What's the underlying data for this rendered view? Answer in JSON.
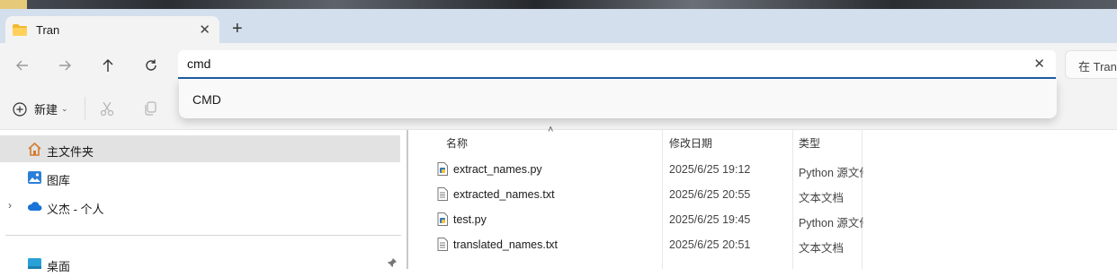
{
  "tab": {
    "title": "Tran"
  },
  "address": {
    "value": "cmd"
  },
  "search": {
    "placeholder": "在 Tran"
  },
  "suggestion": {
    "label": "CMD"
  },
  "toolbar": {
    "new_label": "新建"
  },
  "sidebar": {
    "items": [
      {
        "label": "主文件夹",
        "icon": "home-icon"
      },
      {
        "label": "图库",
        "icon": "gallery-icon"
      },
      {
        "label": "义杰 - 个人",
        "icon": "cloud-icon"
      },
      {
        "label": "桌面",
        "icon": "desktop-icon"
      }
    ]
  },
  "columns": {
    "name": "名称",
    "date": "修改日期",
    "type": "类型"
  },
  "files": [
    {
      "name": "extract_names.py",
      "date": "2025/6/25 19:12",
      "type": "Python 源文件",
      "icon": "python-file-icon"
    },
    {
      "name": "extracted_names.txt",
      "date": "2025/6/25 20:55",
      "type": "文本文档",
      "icon": "text-file-icon"
    },
    {
      "name": "test.py",
      "date": "2025/6/25 19:45",
      "type": "Python 源文件",
      "icon": "python-file-icon"
    },
    {
      "name": "translated_names.txt",
      "date": "2025/6/25 20:51",
      "type": "文本文档",
      "icon": "text-file-icon"
    }
  ],
  "colors": {
    "accent": "#1f5ea8",
    "tabbar": "#d3dfec",
    "selected": "#e2e2e2"
  }
}
